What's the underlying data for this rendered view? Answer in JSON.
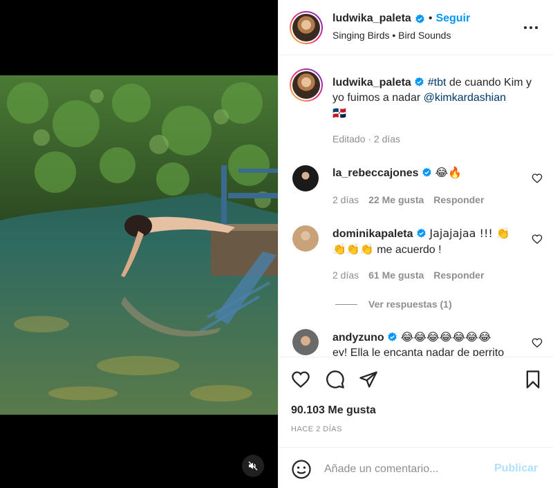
{
  "post": {
    "username": "ludwika_paleta",
    "follow_label": "Seguir",
    "audio": "Singing Birds • Bird Sounds"
  },
  "caption": {
    "username": "ludwika_paleta",
    "hashtag": "#tbt",
    "text_part1": " de cuando Kim y yo fuimos a nadar ",
    "mention": "@kimkardashian",
    "flag": "🇩🇴",
    "meta": "Editado · 2 días"
  },
  "comments": [
    {
      "username": "la_rebeccajones",
      "text": "😂🔥",
      "time": "2 días",
      "likes": "22 Me gusta",
      "reply": "Responder"
    },
    {
      "username": "dominikapaleta",
      "text": "Jajajajaa !!! 👏",
      "text_line2_emoji": "👏👏👏",
      "text_line2": " me acuerdo !",
      "time": "2 días",
      "likes": "61 Me gusta",
      "reply": "Responder",
      "view_replies": "Ver respuestas (1)"
    },
    {
      "username": "andyzuno",
      "text": "😂😂😂😂😂😂😂",
      "text_line2": "ey! Ella le encanta nadar de perrito"
    }
  ],
  "actions": {
    "likes": "90.103 Me gusta",
    "ago": "HACE 2 DÍAS"
  },
  "add_comment": {
    "placeholder": "Añade un comentario...",
    "publish": "Publicar"
  },
  "colors": {
    "accent": "#0095f6",
    "link": "#00376b",
    "muted": "#8e8e8e",
    "publish_disabled": "#b2dffc"
  },
  "icons": {
    "verified": "verified-badge-icon",
    "more": "more-options-icon",
    "like": "heart-icon",
    "comment": "comment-bubble-icon",
    "share": "paper-plane-icon",
    "save": "bookmark-icon",
    "emoji": "smiley-icon",
    "mute": "speaker-muted-icon"
  }
}
